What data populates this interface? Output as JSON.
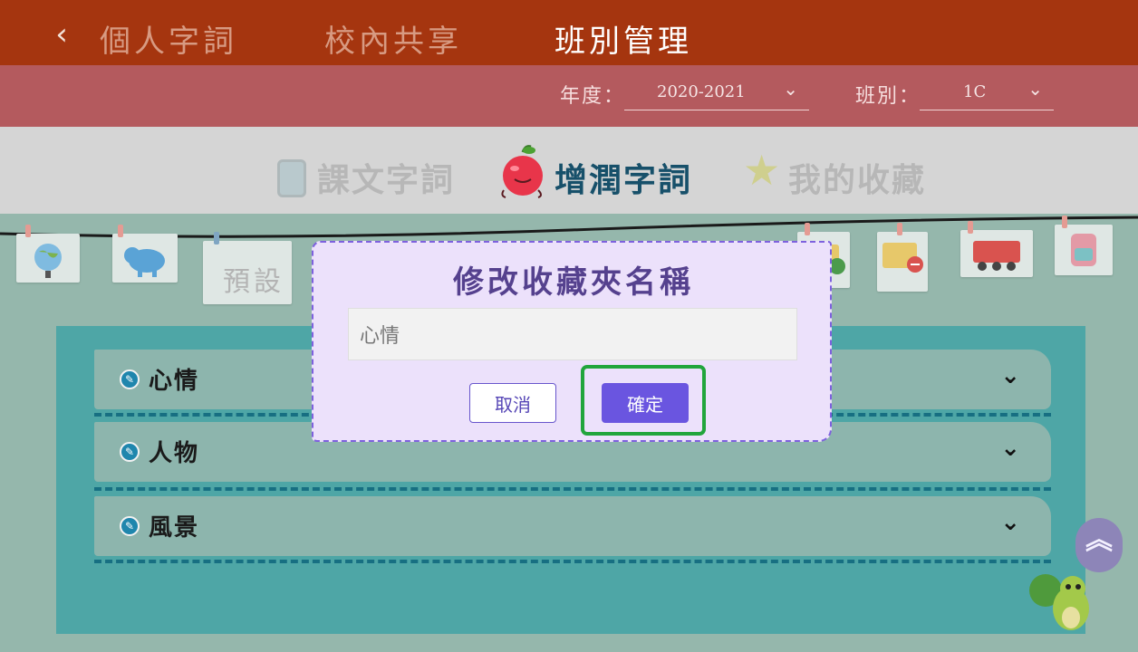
{
  "nav": {
    "back_icon": "chevron-left-icon",
    "tabs": [
      {
        "label": "個人字詞",
        "active": false
      },
      {
        "label": "校內共享",
        "active": false
      },
      {
        "label": "班別管理",
        "active": true
      }
    ]
  },
  "filters": {
    "year_label": "年度：",
    "year_value": "2020-2021",
    "class_label": "班別：",
    "class_value": "1C"
  },
  "categories": [
    {
      "label": "課文字詞",
      "icon": "book-icon",
      "active": false
    },
    {
      "label": "增潤字詞",
      "icon": "apple-icon",
      "active": true
    },
    {
      "label": "我的收藏",
      "icon": "star-icon",
      "active": false
    }
  ],
  "clothesline": {
    "preset_label": "預設",
    "cards": [
      "globe-icon",
      "elephant-icon",
      "preset-card",
      "folder-add-icon",
      "folder-remove-icon",
      "train-icon",
      "backpack-icon"
    ]
  },
  "folders": [
    {
      "name": "心情"
    },
    {
      "name": "人物"
    },
    {
      "name": "風景"
    }
  ],
  "modal": {
    "title": "修改收藏夾名稱",
    "input_value": "心情",
    "cancel_label": "取消",
    "confirm_label": "確定"
  },
  "colors": {
    "nav_bg": "#a5350f",
    "filter_bg": "#b45a5e",
    "panel_bg": "#4ea6a6",
    "modal_bg": "#ece1fb",
    "accent": "#6a55e0",
    "highlight": "#21a53c"
  },
  "widgets": {
    "scroll_top_icon": "double-chevron-up-icon",
    "mascot_icon": "squirrel-mascot-icon"
  }
}
